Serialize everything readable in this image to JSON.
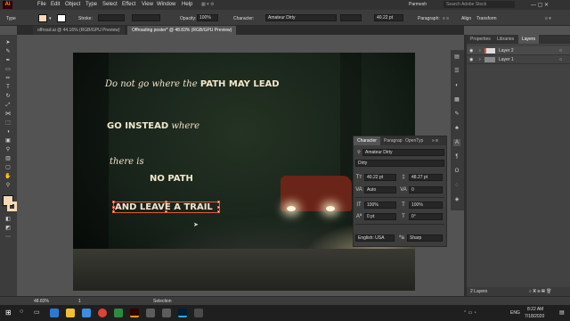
{
  "app": {
    "logo": "Ai"
  },
  "menu": [
    "File",
    "Edit",
    "Object",
    "Type",
    "Select",
    "Effect",
    "View",
    "Window",
    "Help"
  ],
  "user": "Parmesh",
  "search_placeholder": "Search Adobe Stock",
  "control": {
    "type_label": "Type",
    "stroke_label": "Stroke:",
    "opacity_label": "Opacity:",
    "opacity_value": "100%",
    "character_label": "Character:",
    "font": "Amateur Dirty",
    "size": "40.22 pt",
    "paragraph_label": "Paragraph:",
    "align_label": "Align",
    "transform_label": "Transform"
  },
  "doc_tabs": [
    {
      "label": "offroad.ai @ 44.16% (RGB/GPU Preview)"
    },
    {
      "label": "Offroading poster* @ 48.83% (RGB/GPU Preview)"
    }
  ],
  "artboard_text": {
    "line1a": "Do not go where the ",
    "line1b": "PATH MAY LEAD",
    "line2a": "GO INSTEAD",
    "line2b": " where",
    "line3": "there is",
    "line4": "NO PATH",
    "line5": "AND LEAVE A TRAIL"
  },
  "panel_tabs": [
    "Properties",
    "Libraries",
    "Layers"
  ],
  "layers": [
    {
      "name": "Layer 2"
    },
    {
      "name": "Layer 1"
    }
  ],
  "layers_footer": "2 Layers",
  "character_panel": {
    "tabs": [
      "Character",
      "Paragrap",
      "OpenTyp"
    ],
    "font": "Amateur Dirty",
    "style": "Dirty",
    "size": "40.22 pt",
    "leading": "48.27 pt",
    "kerning": "Auto",
    "tracking": "0",
    "vscale": "100%",
    "hscale": "100%",
    "baseline": "0 pt",
    "rotation": "0°",
    "language": "English: USA",
    "antialias": "Sharp"
  },
  "status": {
    "zoom": "48.83%",
    "page": "1",
    "tool": "Selection"
  },
  "taskbar": {
    "time": "8:22 AM",
    "date": "7/18/2020",
    "lang": "ENG"
  },
  "colors": {
    "accent": "#e05a3a",
    "text": "#f2e6cc",
    "fill_swatch": "#f7d9b5"
  }
}
